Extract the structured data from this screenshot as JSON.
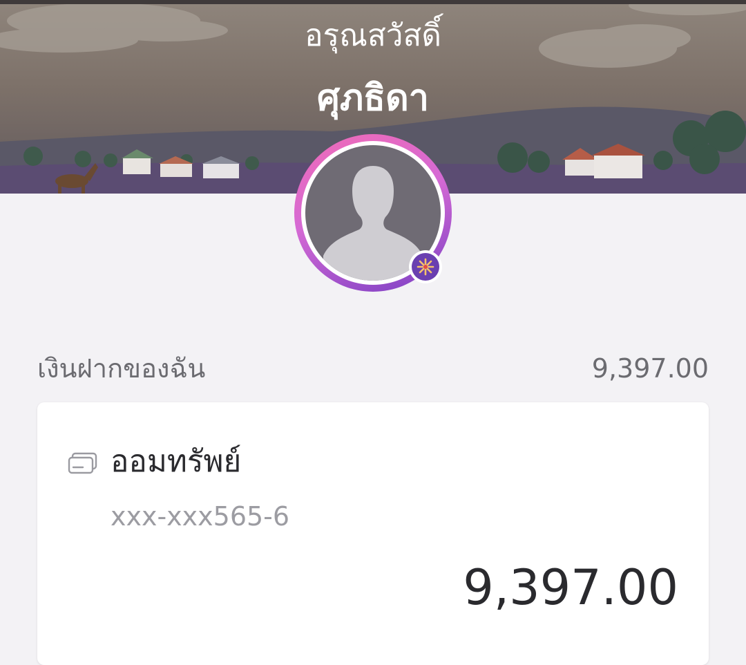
{
  "header": {
    "greeting": "อรุณสวัสดิ์",
    "user_name": "ศุภธิดา",
    "avatar_icon": "default-user-avatar",
    "badge_icon": "sparkle-badge-icon"
  },
  "deposits": {
    "label": "เงินฝากของฉัน",
    "total": "9,397.00"
  },
  "accounts": [
    {
      "icon": "card-icon",
      "name": "ออมทรัพย์",
      "number": "xxx-xxx565-6",
      "balance": "9,397.00"
    }
  ],
  "colors": {
    "ring_start": "#f06bb6",
    "ring_end": "#7b3fc4",
    "badge": "#6a3fb0",
    "background": "#f3f2f5"
  }
}
